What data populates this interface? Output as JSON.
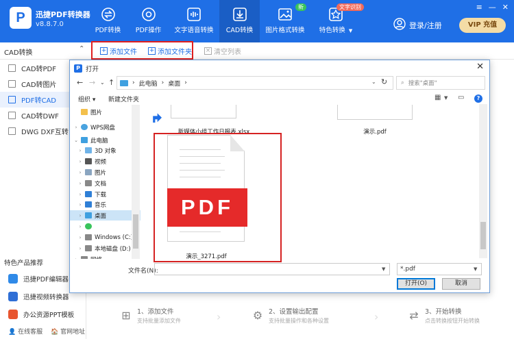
{
  "app": {
    "logo_letter": "P",
    "name": "迅捷PDF转换器",
    "version": "v8.8.7.0",
    "brand_color": "#1f6fe6"
  },
  "nav": [
    {
      "label": "PDF转换",
      "icon": "arrows-icon"
    },
    {
      "label": "PDF操作",
      "icon": "gear-icon"
    },
    {
      "label": "文字语音转换",
      "icon": "audio-wave-icon"
    },
    {
      "label": "CAD转换",
      "icon": "cad-icon",
      "active": true
    },
    {
      "label": "图片格式转换",
      "icon": "image-icon",
      "badge": "新"
    },
    {
      "label": "特色转换",
      "icon": "star-icon",
      "badge": "文字识别",
      "caret": "▼"
    }
  ],
  "header": {
    "login": "登录/注册",
    "vip": "VIP 充值",
    "window_controls": [
      "≡",
      "—",
      "✕"
    ]
  },
  "toolbar": {
    "category": "CAD转换",
    "add_file": "添加文件",
    "add_folder": "添加文件夹",
    "clear_list": "清空列表"
  },
  "sidebar": {
    "items": [
      {
        "label": "CAD转PDF"
      },
      {
        "label": "CAD转图片"
      },
      {
        "label": "PDF转CAD",
        "active": true
      },
      {
        "label": "CAD转DWF"
      },
      {
        "label": "DWG DXF互转"
      }
    ],
    "featured_title": "特色产品推荐",
    "featured": [
      {
        "label": "迅捷PDF编辑器",
        "color": "#2f8ae8"
      },
      {
        "label": "迅捷视频转换器",
        "color": "#2f6fd6"
      },
      {
        "label": "办公资源PPT模板",
        "color": "#e8552f"
      }
    ],
    "links": [
      "在线客服",
      "官网地址"
    ]
  },
  "steps": [
    {
      "title": "1、添加文件",
      "sub": "支持批量添加文件"
    },
    {
      "title": "2、设置输出配置",
      "sub": "支持批量操作和各种设置"
    },
    {
      "title": "3、开始转换",
      "sub": "点击转换按钮开始转换"
    }
  ],
  "dialog": {
    "title": "打开",
    "breadcrumb": [
      "此电脑",
      "桌面"
    ],
    "search_placeholder": "搜索\"桌面\"",
    "organize": "组织 ▾",
    "new_folder": "新建文件夹",
    "tree": [
      {
        "label": "图片",
        "color": "#f3c04c"
      },
      {
        "label": "WPS网盘",
        "color": "#4aa3df"
      },
      {
        "label": "此电脑",
        "color": "#3fa0e0"
      },
      {
        "label": "3D 对象",
        "color": "#6fb3e8"
      },
      {
        "label": "视频",
        "color": "#555"
      },
      {
        "label": "图片",
        "color": "#8aa5c0"
      },
      {
        "label": "文档",
        "color": "#888"
      },
      {
        "label": "下载",
        "color": "#2f7fd6"
      },
      {
        "label": "音乐",
        "color": "#2f7fd6"
      },
      {
        "label": "桌面",
        "color": "#3fa0e0",
        "selected": true
      },
      {
        "label": "",
        "color": "#3ac45c"
      },
      {
        "label": "Windows (C:)",
        "color": "#888"
      },
      {
        "label": "本地磁盘 (D:)",
        "color": "#888"
      },
      {
        "label": "网络",
        "color": "#888"
      }
    ],
    "files": [
      {
        "name": "新媒体小组工作日报表.xlsx"
      },
      {
        "name": "演示.pdf"
      },
      {
        "name": "演示_3271.pdf",
        "selected": true
      }
    ],
    "pdf_text": "PDF",
    "filename_label": "文件名(N):",
    "filename_value": "",
    "filetype": "*.pdf",
    "open": "打开(O)",
    "cancel": "取消"
  }
}
